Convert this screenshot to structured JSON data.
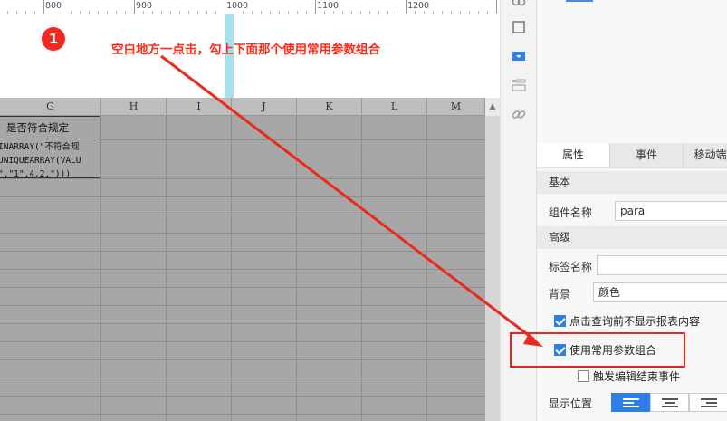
{
  "ruler": {
    "labels": [
      "800",
      "900",
      "1000",
      "1100",
      "1200"
    ]
  },
  "annotation": {
    "step_number": "1",
    "instruction": "空白地方一点击，勾上下面那个使用常用参数组合",
    "color": "#ff2a1a"
  },
  "grid": {
    "columns": [
      "G",
      "H",
      "I",
      "J",
      "K",
      "L",
      "M"
    ],
    "cell_header": "是否符合规定",
    "cell_formula_lines": [
      "INARRAY(\"不符合规",
      "UNIQUEARRAY(VALU",
      "\",\"1\",4,2,\")))"
    ]
  },
  "toolbar": {
    "icons": [
      "link-icon-top",
      "frame-icon",
      "dropdown-widget-icon",
      "list-icon",
      "link-icon"
    ]
  },
  "panel": {
    "tabs": [
      "属性",
      "事件",
      "移动端"
    ],
    "active_tab": "属性",
    "section_basic": "基本",
    "component_name_label": "组件名称",
    "component_name_value": "para",
    "section_advanced": "高级",
    "tag_name_label": "标签名称",
    "tag_name_value": "",
    "background_label": "背景",
    "background_value": "颜色",
    "option_hide_report": "点击查询前不显示报表内容",
    "option_hide_report_checked": true,
    "option_common_params": "使用常用参数组合",
    "option_common_params_checked": true,
    "option_trigger_edit": "触发编辑结束事件",
    "option_trigger_edit_checked": false,
    "display_position_label": "显示位置",
    "accent": "#2f7fe8"
  }
}
